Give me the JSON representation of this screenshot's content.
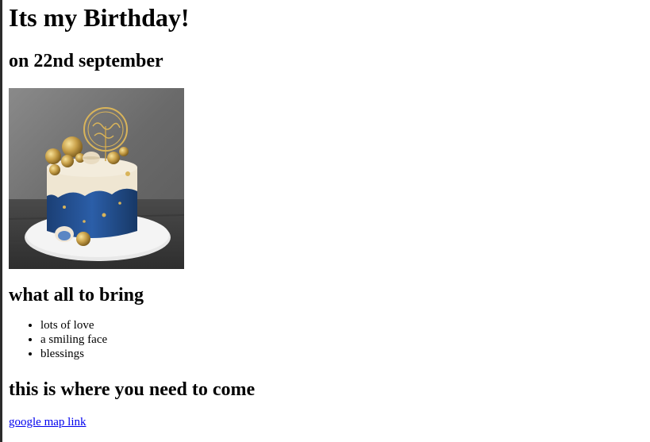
{
  "page": {
    "title": "Its my Birthday!",
    "subtitle": "on 22nd september"
  },
  "photo": {
    "alt": "birthday cake",
    "icon": "cake-photo"
  },
  "bring": {
    "heading": "what all to bring",
    "items": [
      "lots of love",
      "a smiling face",
      "blessings"
    ]
  },
  "location": {
    "heading": "this is where you need to come",
    "link_label": "google map link"
  },
  "colors": {
    "link": "#0000ee",
    "cake_blue": "#1f4e8c",
    "cake_cream": "#efe6d2",
    "gold": "#c9a14a"
  }
}
